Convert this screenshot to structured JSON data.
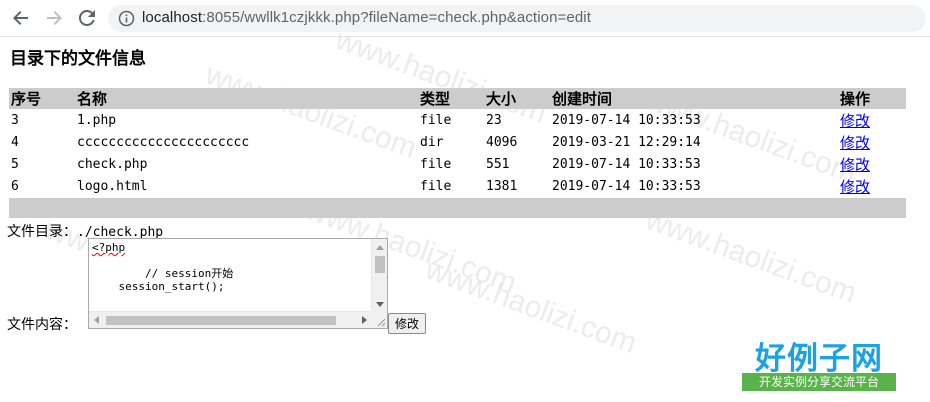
{
  "browser": {
    "url_host": "localhost",
    "url_rest": ":8055/wwllk1czjkkk.php?fileName=check.php&action=edit",
    "back_icon": "arrow-left-icon",
    "forward_icon": "arrow-right-icon",
    "reload_icon": "reload-icon",
    "info_icon": "info-circle-icon"
  },
  "page": {
    "title": "目录下的文件信息"
  },
  "table": {
    "headers": [
      "序号",
      "名称",
      "类型",
      "大小",
      "创建时间",
      "操作"
    ],
    "rows": [
      {
        "no": "3",
        "name": "1.php",
        "type": "file",
        "size": "23",
        "time": "2019-07-14 10:33:53",
        "op": "修改"
      },
      {
        "no": "4",
        "name": "cccccccccccccccccccccc",
        "type": "dir",
        "size": "4096",
        "time": "2019-03-21 12:29:14",
        "op": "修改"
      },
      {
        "no": "5",
        "name": "check.php",
        "type": "file",
        "size": "551",
        "time": "2019-07-14 10:33:53",
        "op": "修改"
      },
      {
        "no": "6",
        "name": "logo.html",
        "type": "file",
        "size": "1381",
        "time": "2019-07-14 10:33:53",
        "op": "修改"
      }
    ]
  },
  "form": {
    "dir_label": "文件目录：",
    "dir_value": "./check.php",
    "content_label": "文件内容：",
    "editor_line1": "<?php",
    "editor_rest": "\n\n        // session开始\n    session_start();",
    "submit_label": "修改"
  },
  "watermark": {
    "text": "www.haolizi.com"
  },
  "logo": {
    "main": "好例子网",
    "sub": "开发实例分享交流平台"
  },
  "colors": {
    "header_bg": "#cccccc",
    "link": "#0000ee",
    "logo_blue": "#1aa3e0",
    "logo_green": "#59b24a"
  }
}
